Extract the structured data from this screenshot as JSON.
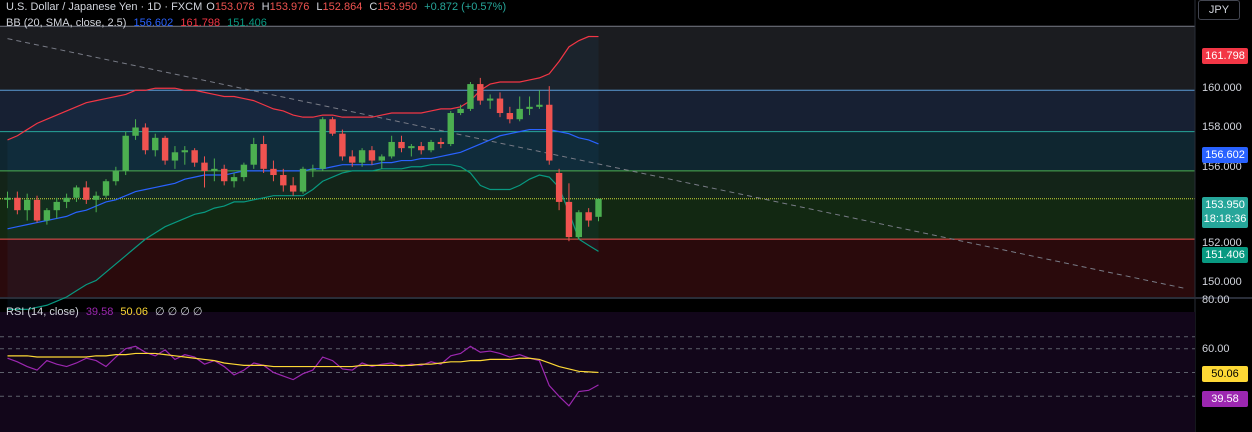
{
  "header": {
    "symbol": "U.S. Dollar / Japanese Yen · 1D · FXCM",
    "o_label": "O",
    "o": "153.078",
    "h_label": "H",
    "h": "153.976",
    "l_label": "L",
    "l": "152.864",
    "c_label": "C",
    "c": "153.950",
    "change": "+0.872 (+0.57%)",
    "currency": "JPY"
  },
  "bb_legend": {
    "label": "BB (20, SMA, close, 2.5)",
    "basis": "156.602",
    "upper": "161.798",
    "lower": "151.406"
  },
  "rsi_legend": {
    "label": "RSI (14, close)",
    "rsi": "39.58",
    "ma": "50.06",
    "rest": "∅ ∅ ∅ ∅"
  },
  "price_axis": {
    "ticks": [
      "160.000",
      "158.000",
      "156.000",
      "152.000",
      "150.000"
    ],
    "badge_upper": "161.798",
    "badge_basis": "156.602",
    "badge_price": "153.950",
    "badge_countdown": "18:18:36",
    "badge_lower": "151.406"
  },
  "rsi_axis": {
    "ticks": [
      "80.00",
      "60.00"
    ],
    "badge_ma": "50.06",
    "badge_rsi": "39.58"
  },
  "colors": {
    "up": "#26a69a",
    "up_body": "#4caf50",
    "down": "#ef5350",
    "upper": "#f23645",
    "basis": "#2962ff",
    "lower": "#089981",
    "rsi": "#9c27b0",
    "rsi_ma": "#fdd835"
  },
  "chart_data": {
    "type": "candlestick",
    "y_range": [
      149.2,
      162.6
    ],
    "candles": [
      {
        "o": 153.9,
        "h": 154.3,
        "l": 153.5,
        "c": 154.0
      },
      {
        "o": 154.0,
        "h": 154.3,
        "l": 153.2,
        "c": 153.4
      },
      {
        "o": 153.4,
        "h": 154.2,
        "l": 152.9,
        "c": 153.9
      },
      {
        "o": 153.9,
        "h": 154.1,
        "l": 152.8,
        "c": 152.9
      },
      {
        "o": 152.9,
        "h": 153.5,
        "l": 152.7,
        "c": 153.4
      },
      {
        "o": 153.4,
        "h": 154.0,
        "l": 153.0,
        "c": 153.8
      },
      {
        "o": 153.8,
        "h": 154.2,
        "l": 153.5,
        "c": 154.0
      },
      {
        "o": 154.0,
        "h": 154.6,
        "l": 153.8,
        "c": 154.5
      },
      {
        "o": 154.5,
        "h": 154.8,
        "l": 153.7,
        "c": 153.9
      },
      {
        "o": 153.9,
        "h": 154.3,
        "l": 153.3,
        "c": 154.1
      },
      {
        "o": 154.1,
        "h": 154.9,
        "l": 154.0,
        "c": 154.8
      },
      {
        "o": 154.8,
        "h": 155.5,
        "l": 154.6,
        "c": 155.3
      },
      {
        "o": 155.3,
        "h": 157.2,
        "l": 155.1,
        "c": 157.0
      },
      {
        "o": 157.0,
        "h": 157.8,
        "l": 156.8,
        "c": 157.4
      },
      {
        "o": 157.4,
        "h": 157.6,
        "l": 156.1,
        "c": 156.3
      },
      {
        "o": 156.3,
        "h": 157.1,
        "l": 156.0,
        "c": 156.9
      },
      {
        "o": 156.9,
        "h": 157.0,
        "l": 155.6,
        "c": 155.8
      },
      {
        "o": 155.8,
        "h": 156.5,
        "l": 155.4,
        "c": 156.2
      },
      {
        "o": 156.2,
        "h": 156.5,
        "l": 155.6,
        "c": 156.3
      },
      {
        "o": 156.3,
        "h": 156.4,
        "l": 155.5,
        "c": 155.7
      },
      {
        "o": 155.7,
        "h": 156.0,
        "l": 154.5,
        "c": 155.3
      },
      {
        "o": 155.3,
        "h": 155.9,
        "l": 154.8,
        "c": 155.4
      },
      {
        "o": 155.4,
        "h": 155.6,
        "l": 154.6,
        "c": 154.8
      },
      {
        "o": 154.8,
        "h": 155.2,
        "l": 154.5,
        "c": 155.0
      },
      {
        "o": 155.0,
        "h": 155.7,
        "l": 154.8,
        "c": 155.6
      },
      {
        "o": 155.6,
        "h": 156.9,
        "l": 155.4,
        "c": 156.6
      },
      {
        "o": 156.6,
        "h": 157.0,
        "l": 155.2,
        "c": 155.4
      },
      {
        "o": 155.4,
        "h": 155.8,
        "l": 154.8,
        "c": 155.1
      },
      {
        "o": 155.1,
        "h": 155.4,
        "l": 154.3,
        "c": 154.6
      },
      {
        "o": 154.6,
        "h": 155.0,
        "l": 154.1,
        "c": 154.3
      },
      {
        "o": 154.3,
        "h": 155.5,
        "l": 154.2,
        "c": 155.4
      },
      {
        "o": 155.4,
        "h": 155.6,
        "l": 155.0,
        "c": 155.4
      },
      {
        "o": 155.4,
        "h": 157.9,
        "l": 155.3,
        "c": 157.8
      },
      {
        "o": 157.8,
        "h": 157.9,
        "l": 157.0,
        "c": 157.1
      },
      {
        "o": 157.1,
        "h": 157.3,
        "l": 155.8,
        "c": 156.0
      },
      {
        "o": 156.0,
        "h": 156.3,
        "l": 155.5,
        "c": 155.7
      },
      {
        "o": 155.7,
        "h": 156.4,
        "l": 155.5,
        "c": 156.3
      },
      {
        "o": 156.3,
        "h": 156.5,
        "l": 155.6,
        "c": 155.8
      },
      {
        "o": 155.8,
        "h": 156.1,
        "l": 155.4,
        "c": 156.0
      },
      {
        "o": 156.0,
        "h": 157.0,
        "l": 155.9,
        "c": 156.7
      },
      {
        "o": 156.7,
        "h": 157.0,
        "l": 156.2,
        "c": 156.4
      },
      {
        "o": 156.4,
        "h": 156.6,
        "l": 156.0,
        "c": 156.5
      },
      {
        "o": 156.5,
        "h": 156.7,
        "l": 156.1,
        "c": 156.3
      },
      {
        "o": 156.3,
        "h": 156.8,
        "l": 156.2,
        "c": 156.7
      },
      {
        "o": 156.7,
        "h": 156.9,
        "l": 156.4,
        "c": 156.6
      },
      {
        "o": 156.6,
        "h": 158.2,
        "l": 156.5,
        "c": 158.1
      },
      {
        "o": 158.1,
        "h": 158.5,
        "l": 158.0,
        "c": 158.3
      },
      {
        "o": 158.3,
        "h": 159.6,
        "l": 158.2,
        "c": 159.5
      },
      {
        "o": 159.5,
        "h": 159.8,
        "l": 158.5,
        "c": 158.7
      },
      {
        "o": 158.7,
        "h": 159.0,
        "l": 158.3,
        "c": 158.8
      },
      {
        "o": 158.8,
        "h": 159.1,
        "l": 157.9,
        "c": 158.1
      },
      {
        "o": 158.1,
        "h": 158.4,
        "l": 157.6,
        "c": 157.8
      },
      {
        "o": 157.8,
        "h": 158.9,
        "l": 157.7,
        "c": 158.3
      },
      {
        "o": 158.3,
        "h": 158.9,
        "l": 158.0,
        "c": 158.4
      },
      {
        "o": 158.4,
        "h": 159.2,
        "l": 158.3,
        "c": 158.5
      },
      {
        "o": 158.5,
        "h": 159.4,
        "l": 155.6,
        "c": 155.8
      },
      {
        "o": 155.2,
        "h": 155.4,
        "l": 153.4,
        "c": 153.8
      },
      {
        "o": 153.8,
        "h": 154.7,
        "l": 151.9,
        "c": 152.1
      },
      {
        "o": 152.1,
        "h": 153.4,
        "l": 152.0,
        "c": 153.3
      },
      {
        "o": 153.3,
        "h": 153.5,
        "l": 152.6,
        "c": 152.9
      },
      {
        "o": 153.078,
        "h": 153.976,
        "l": 152.864,
        "c": 153.95
      }
    ],
    "bb_upper": [
      156.8,
      157.0,
      157.3,
      157.6,
      157.8,
      158.0,
      158.2,
      158.4,
      158.6,
      158.7,
      158.8,
      158.9,
      159.0,
      159.2,
      159.2,
      159.3,
      159.3,
      159.3,
      159.2,
      159.2,
      159.1,
      159.0,
      158.9,
      158.9,
      158.8,
      158.7,
      158.5,
      158.3,
      158.2,
      158.0,
      157.9,
      157.9,
      158.0,
      158.0,
      157.9,
      157.9,
      157.9,
      157.9,
      158.0,
      158.1,
      158.1,
      158.1,
      158.1,
      158.2,
      158.3,
      158.3,
      158.4,
      158.7,
      159.2,
      159.5,
      159.6,
      159.6,
      159.6,
      159.7,
      159.8,
      160.0,
      160.6,
      161.3,
      161.6,
      161.8,
      161.798
    ],
    "bb_basis": [
      152.5,
      152.6,
      152.7,
      152.8,
      152.9,
      153.0,
      153.1,
      153.3,
      153.4,
      153.6,
      153.8,
      153.9,
      154.1,
      154.3,
      154.4,
      154.5,
      154.6,
      154.7,
      154.9,
      155.0,
      155.1,
      155.1,
      155.1,
      155.2,
      155.3,
      155.3,
      155.3,
      155.3,
      155.3,
      155.3,
      155.3,
      155.4,
      155.4,
      155.5,
      155.6,
      155.6,
      155.6,
      155.6,
      155.7,
      155.7,
      155.8,
      155.8,
      155.9,
      155.9,
      156.0,
      156.1,
      156.2,
      156.4,
      156.6,
      156.8,
      157.0,
      157.1,
      157.2,
      157.3,
      157.3,
      157.3,
      157.2,
      157.1,
      156.9,
      156.8,
      156.602
    ],
    "bb_lower": [
      148.6,
      148.6,
      148.6,
      148.7,
      148.8,
      149.0,
      149.2,
      149.5,
      149.8,
      150.0,
      150.4,
      150.8,
      151.2,
      151.6,
      152.0,
      152.3,
      152.6,
      152.8,
      153.0,
      153.2,
      153.3,
      153.5,
      153.6,
      153.8,
      153.8,
      153.9,
      154.0,
      154.1,
      154.1,
      154.1,
      154.1,
      154.4,
      154.8,
      155.0,
      155.2,
      155.3,
      155.3,
      155.3,
      155.4,
      155.4,
      155.4,
      155.5,
      155.5,
      155.6,
      155.6,
      155.6,
      155.5,
      155.2,
      154.6,
      154.4,
      154.4,
      154.4,
      154.6,
      154.9,
      155.1,
      155.0,
      154.5,
      153.3,
      152.0,
      151.7,
      151.406
    ],
    "trendline": [
      [
        0,
        161.7
      ],
      [
        82,
        150.0
      ]
    ],
    "levels": [
      162.3,
      159.2,
      157.2,
      155.3,
      153.95,
      152.0
    ],
    "rsi": {
      "range": [
        0,
        100
      ],
      "bands": [
        80,
        70,
        50,
        30
      ],
      "values": [
        62,
        59,
        55,
        52,
        60,
        57,
        55,
        58,
        62,
        60,
        55,
        63,
        70,
        72,
        67,
        64,
        69,
        61,
        65,
        63,
        57,
        60,
        55,
        48,
        52,
        58,
        56,
        50,
        47,
        44,
        49,
        52,
        63,
        60,
        53,
        52,
        58,
        55,
        57,
        58,
        55,
        57,
        56,
        59,
        57,
        64,
        66,
        72,
        67,
        68,
        66,
        63,
        65,
        62,
        60,
        39,
        30,
        22,
        34,
        35,
        39.58
      ],
      "ma": [
        64,
        64,
        64,
        63,
        63,
        63,
        63,
        63,
        63,
        64,
        64,
        65,
        65,
        66,
        66,
        66,
        65,
        64,
        63,
        62,
        61,
        60,
        58,
        57,
        56,
        56,
        56,
        55,
        55,
        55,
        55,
        55,
        55,
        55,
        55,
        55,
        56,
        56,
        56,
        56,
        56,
        56,
        57,
        57,
        58,
        59,
        59,
        60,
        60,
        61,
        61,
        61,
        62,
        62,
        61,
        58,
        55,
        53,
        51,
        50.5,
        50.06
      ]
    }
  }
}
